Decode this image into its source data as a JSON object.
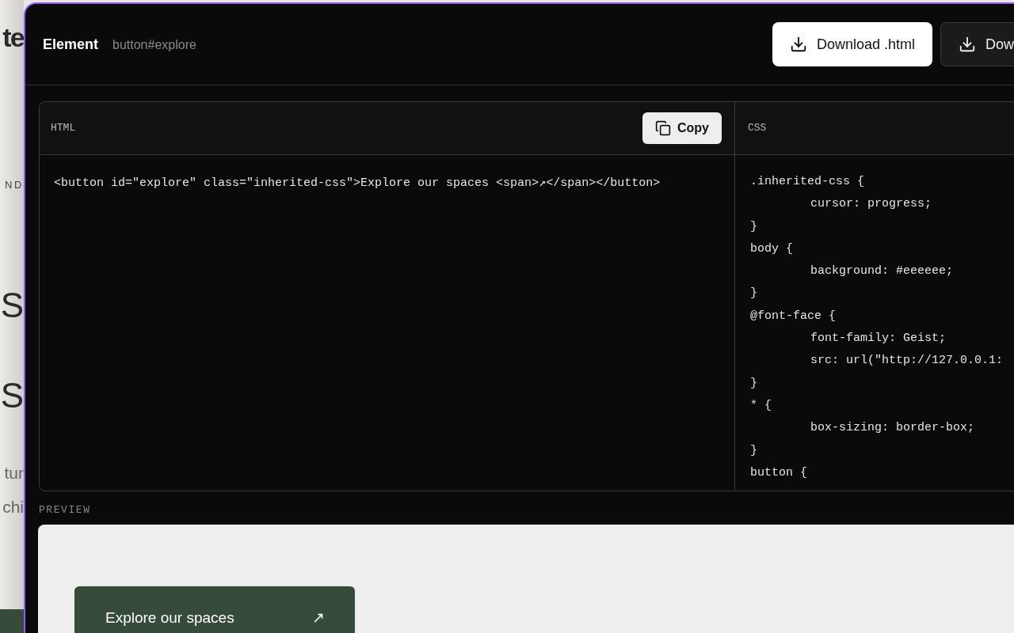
{
  "background_page": {
    "fragments": [
      {
        "text": "te",
        "kind": "heading"
      },
      {
        "text": "ND",
        "kind": "label"
      },
      {
        "text": "S",
        "kind": "display"
      },
      {
        "text": "S",
        "kind": "display"
      },
      {
        "text": "tur",
        "kind": "body"
      },
      {
        "text": "chi",
        "kind": "body"
      }
    ]
  },
  "header": {
    "title": "Element",
    "selector": "button#explore",
    "buttons": [
      {
        "label": "Download .html",
        "kind": "primary"
      },
      {
        "label": "Dow",
        "kind": "secondary"
      }
    ]
  },
  "code_panels": [
    {
      "title": "HTML",
      "copy_button": "Copy",
      "lines": [
        {
          "text": "<button id=\"explore\" class=\"inherited-css\">Explore our spaces <span>↗</span></button>",
          "indented": false
        }
      ]
    },
    {
      "title": "CSS",
      "lines": [
        {
          "text": ".inherited-css {",
          "indented": false
        },
        {
          "text": "cursor: progress;",
          "indented": true
        },
        {
          "text": "}",
          "indented": false
        },
        {
          "text": "body {",
          "indented": false
        },
        {
          "text": "background: #eeeeee;",
          "indented": true
        },
        {
          "text": "}",
          "indented": false
        },
        {
          "text": "@font-face {",
          "indented": false
        },
        {
          "text": "font-family: Geist;",
          "indented": true
        },
        {
          "text": "src: url(\"http://127.0.0.1:",
          "indented": true
        },
        {
          "text": "}",
          "indented": false
        },
        {
          "text": "* {",
          "indented": false
        },
        {
          "text": "box-sizing: border-box;",
          "indented": true
        },
        {
          "text": "}",
          "indented": false
        },
        {
          "text": "button {",
          "indented": false
        }
      ]
    }
  ],
  "preview": {
    "label": "PREVIEW",
    "button": {
      "label": "Explore our spaces",
      "icon": "↗"
    }
  }
}
